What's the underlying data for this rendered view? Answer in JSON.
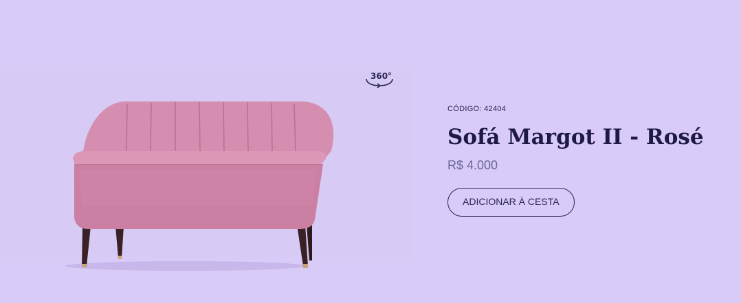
{
  "product": {
    "code_label": "CÓDIGO:",
    "code_value": "42404",
    "name": "Sofá Margot II - Rosé",
    "price": "R$ 4.000",
    "add_to_cart_label": "ADICIONAR À CESTA"
  },
  "viewer": {
    "rotate_label": "360°",
    "icon": "rotate-360-icon"
  },
  "colors": {
    "background": "#d9cbf7",
    "sofa": "#d188ac",
    "text_dark": "#1e1a45",
    "price_text": "#6a6699"
  }
}
